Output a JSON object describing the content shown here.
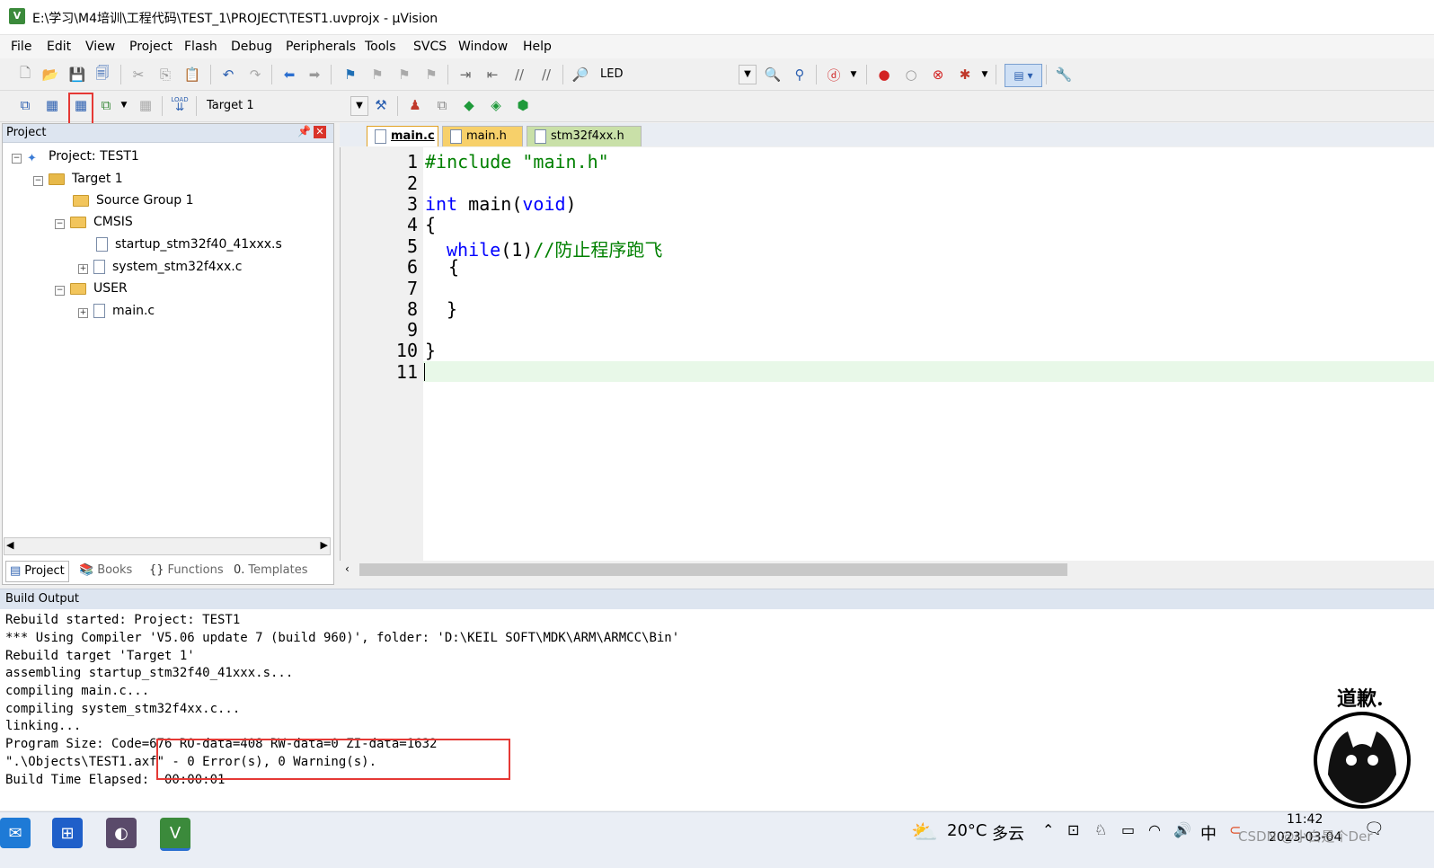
{
  "window": {
    "title": "E:\\学习\\M4培训\\工程代码\\TEST_1\\PROJECT\\TEST1.uvprojx - µVision",
    "app_icon": "V"
  },
  "menu": [
    "File",
    "Edit",
    "View",
    "Project",
    "Flash",
    "Debug",
    "Peripherals",
    "Tools",
    "SVCS",
    "Window",
    "Help"
  ],
  "toolbar1": {
    "target_combo": "LED"
  },
  "toolbar2": {
    "target_select": "Target 1",
    "load_label": "LOAD"
  },
  "project_panel": {
    "title": "Project",
    "tree": [
      {
        "label": "Project: TEST1",
        "type": "project"
      },
      {
        "label": "Target 1",
        "type": "target"
      },
      {
        "label": "Source Group 1",
        "type": "folder"
      },
      {
        "label": "CMSIS",
        "type": "folder"
      },
      {
        "label": "startup_stm32f40_41xxx.s",
        "type": "file"
      },
      {
        "label": "system_stm32f4xx.c",
        "type": "file"
      },
      {
        "label": "USER",
        "type": "folder"
      },
      {
        "label": "main.c",
        "type": "file"
      }
    ],
    "tabs": [
      "Project",
      "Books",
      "Functions",
      "Templates"
    ]
  },
  "editor": {
    "tabs": [
      "main.c",
      "main.h",
      "stm32f4xx.h"
    ],
    "active_tab": "main.c",
    "line_numbers": [
      "1",
      "2",
      "3",
      "4",
      "5",
      "6",
      "7",
      "8",
      "9",
      "10",
      "11"
    ],
    "code": {
      "l1_directive": "#include",
      "l1_string": "\"main.h\"",
      "l3_kw": "int",
      "l3_fn": " main(",
      "l3_void": "void",
      "l3_close": ")",
      "l4": "{",
      "l5_kw": "while",
      "l5_cond": "(1)",
      "l5_comment": "//防止程序跑飞",
      "l6": "{",
      "l8": "}",
      "l10": "}"
    }
  },
  "build_output": {
    "title": "Build Output",
    "lines": [
      "Rebuild started: Project: TEST1",
      "*** Using Compiler 'V5.06 update 7 (build 960)', folder: 'D:\\KEIL SOFT\\MDK\\ARM\\ARMCC\\Bin'",
      "Rebuild target 'Target 1'",
      "assembling startup_stm32f40_41xxx.s...",
      "compiling main.c...",
      "compiling system_stm32f4xx.c...",
      "linking...",
      "Program Size: Code=676 RO-data=408 RW-data=0 ZI-data=1632",
      "\".\\Objects\\TEST1.axf\" - 0 Error(s), 0 Warning(s).",
      "Build Time Elapsed:  00:00:01"
    ]
  },
  "taskbar": {
    "weather_temp": "20°C",
    "weather_desc": "多云",
    "ime": "中",
    "time": "11:42",
    "date": "2023-03-04",
    "watermark": "CSDN @小白是个Der"
  },
  "overlay": {
    "stamp_text": "道歉."
  },
  "colors": {
    "keyword": "#0000ff",
    "string": "#a31515",
    "comment": "#008000",
    "highlight": "#e53935"
  }
}
